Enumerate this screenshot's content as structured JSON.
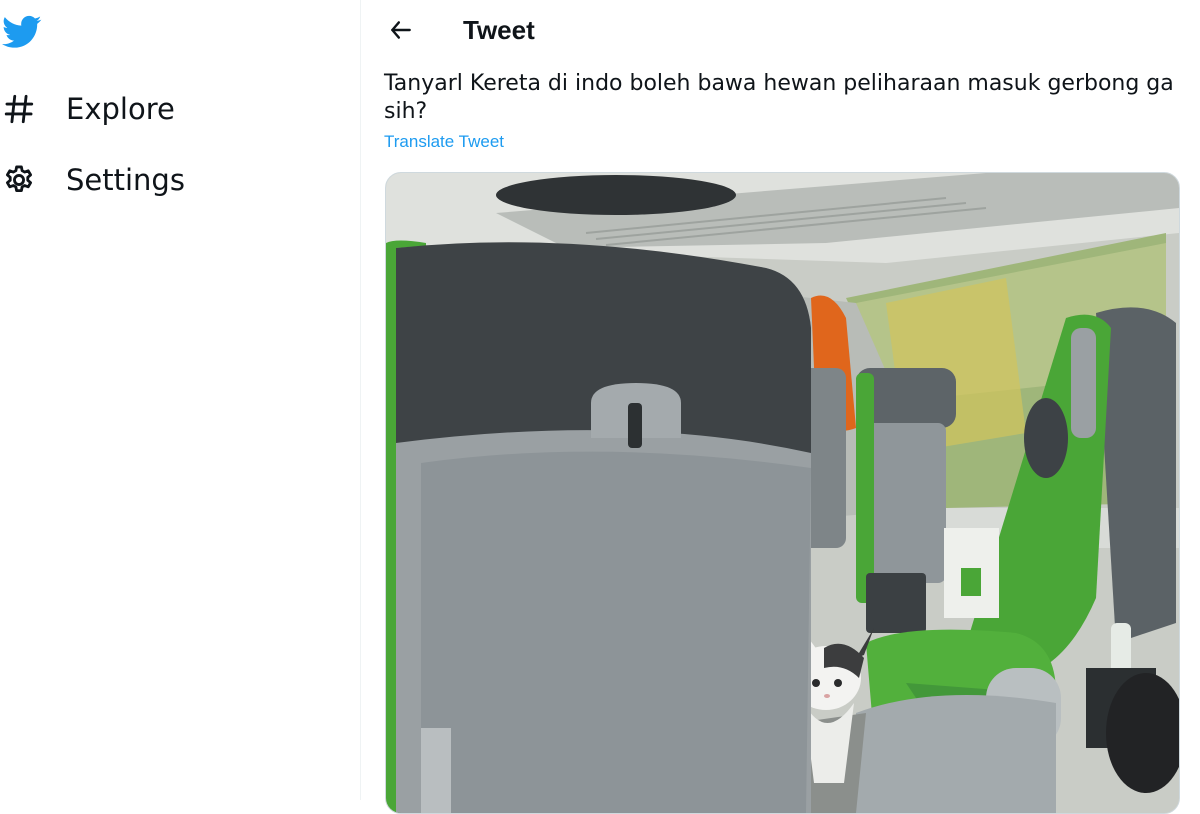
{
  "sidebar": {
    "logo_icon": "twitter-bird-icon",
    "items": [
      {
        "label": "Explore",
        "icon": "hashtag-icon"
      },
      {
        "label": "Settings",
        "icon": "gear-icon"
      }
    ]
  },
  "header": {
    "back_icon": "arrow-left-icon",
    "title": "Tweet"
  },
  "tweet": {
    "text": "Tanyarl Kereta di indo boleh bawa hewan peliharaan masuk gerbong ga sih?",
    "translate_label": "Translate Tweet",
    "media": {
      "type": "photo"
    }
  },
  "colors": {
    "brand": "#1d9bf0",
    "text": "#0f1419",
    "seat_green": "#4aa637",
    "seat_grey": "#8e9498"
  }
}
